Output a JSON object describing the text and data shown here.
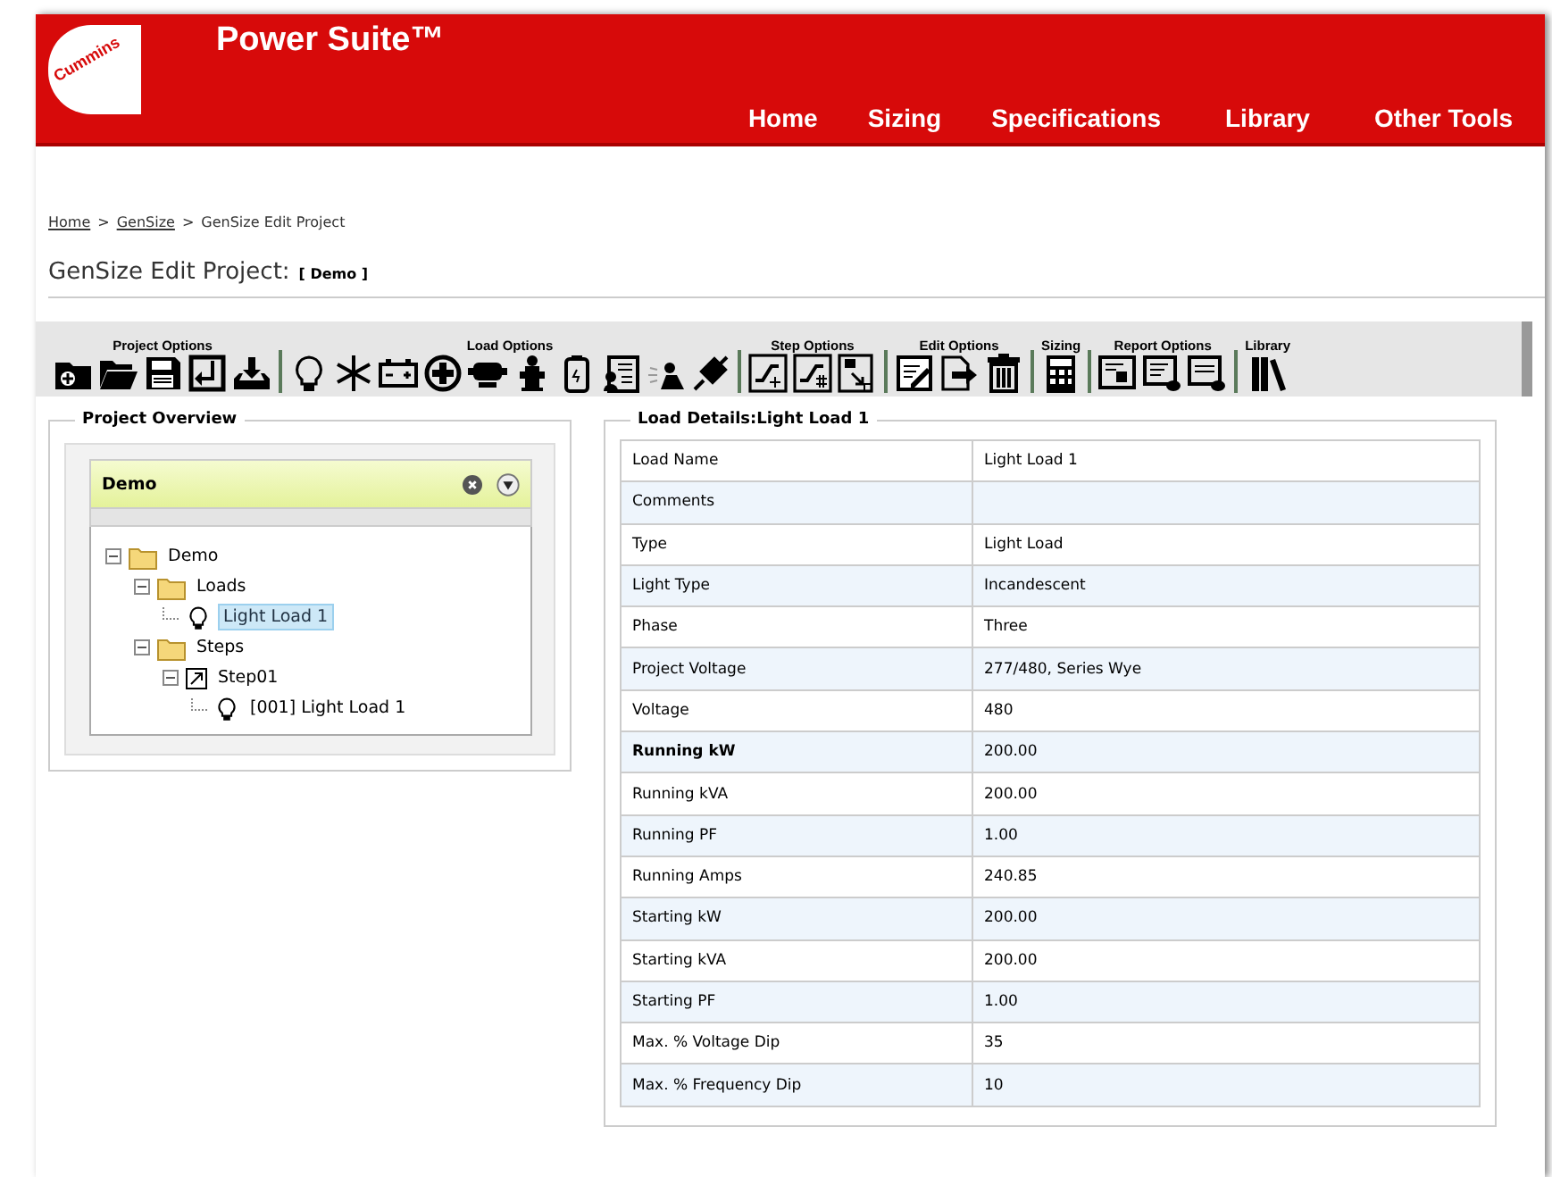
{
  "header": {
    "logo": "Cummins",
    "title": "Power Suite™"
  },
  "nav": [
    {
      "label": "Home"
    },
    {
      "label": "Sizing"
    },
    {
      "label": "Specifications"
    },
    {
      "label": "Library"
    },
    {
      "label": "Other Tools"
    }
  ],
  "breadcrumb": [
    {
      "label": "Home",
      "link": true
    },
    {
      "separator": ">",
      "label": "GenSize",
      "link": true
    },
    {
      "separator": ">",
      "label": "GenSize Edit Project",
      "link": false
    }
  ],
  "page_title": {
    "text": "GenSize Edit Project:",
    "project": "[ Demo ]"
  },
  "toolbar": [
    {
      "label": "Project Options",
      "icons": [
        {
          "kind": "folder-add"
        },
        {
          "kind": "folder-open"
        },
        {
          "kind": "save"
        },
        {
          "kind": "import"
        },
        {
          "kind": "download"
        }
      ]
    },
    {
      "label": "Load Options",
      "icons": [
        {
          "kind": "bulb"
        },
        {
          "kind": "snowflake"
        },
        {
          "kind": "battery"
        },
        {
          "kind": "plus-circle"
        },
        {
          "kind": "monitor"
        },
        {
          "kind": "hydrant"
        },
        {
          "kind": "phone"
        },
        {
          "kind": "document"
        },
        {
          "kind": "welder"
        },
        {
          "kind": "plug"
        }
      ]
    },
    {
      "label": "Step Options",
      "icons": [
        {
          "kind": "step-add"
        },
        {
          "kind": "step-number"
        },
        {
          "kind": "step-list"
        }
      ]
    },
    {
      "label": "Edit Options",
      "icons": [
        {
          "kind": "edit"
        },
        {
          "kind": "export"
        },
        {
          "kind": "trash"
        }
      ]
    },
    {
      "label": "Sizing",
      "icons": [
        {
          "kind": "calculator"
        }
      ]
    },
    {
      "label": "Report Options",
      "icons": [
        {
          "kind": "report"
        },
        {
          "kind": "report-db"
        },
        {
          "kind": "report-list"
        }
      ]
    },
    {
      "label": "Library",
      "icons": [
        {
          "kind": "books"
        }
      ]
    }
  ],
  "overview": {
    "title": "Project Overview",
    "panel_title": "Demo",
    "tree": [
      {
        "label": "Demo",
        "kind": "folder",
        "selected": false,
        "children": [
          {
            "label": "Loads",
            "kind": "folder",
            "selected": false,
            "children": [
              {
                "label": "Light Load 1",
                "kind": "bulb",
                "selected": true
              }
            ]
          },
          {
            "label": "Steps",
            "kind": "folder",
            "selected": false,
            "children": [
              {
                "label": "Step01",
                "kind": "step",
                "selected": false,
                "children": [
                  {
                    "label": "[001] Light Load 1",
                    "kind": "bulb",
                    "selected": false
                  }
                ]
              }
            ]
          }
        ]
      }
    ]
  },
  "details": {
    "title": "Load Details:Light Load 1",
    "rows": [
      {
        "label": "Load Name",
        "value": "Light Load 1",
        "bold": false
      },
      {
        "label": "Comments",
        "bold": false
      },
      {
        "label": "Type",
        "value": "Light Load",
        "bold": false
      },
      {
        "label": "Light Type",
        "value": "Incandescent",
        "bold": false
      },
      {
        "label": "Phase",
        "value": "Three",
        "bold": false
      },
      {
        "label": "Project Voltage",
        "value": "277/480, Series Wye",
        "bold": false
      },
      {
        "label": "Voltage",
        "value": "480",
        "bold": false
      },
      {
        "label": "Running kW",
        "value": "200.00",
        "bold": true
      },
      {
        "label": "Running kVA",
        "value": "200.00",
        "bold": false
      },
      {
        "label": "Running PF",
        "value": "1.00",
        "bold": false
      },
      {
        "label": "Running Amps",
        "value": "240.85",
        "bold": false
      },
      {
        "label": "Starting kW",
        "value": "200.00",
        "bold": false
      },
      {
        "label": "Starting kVA",
        "value": "200.00",
        "bold": false
      },
      {
        "label": "Starting PF",
        "value": "1.00",
        "bold": false
      },
      {
        "label": "Max. % Voltage Dip",
        "value": "35",
        "bold": false
      },
      {
        "label": "Max. % Frequency Dip",
        "value": "10",
        "bold": false
      }
    ]
  }
}
